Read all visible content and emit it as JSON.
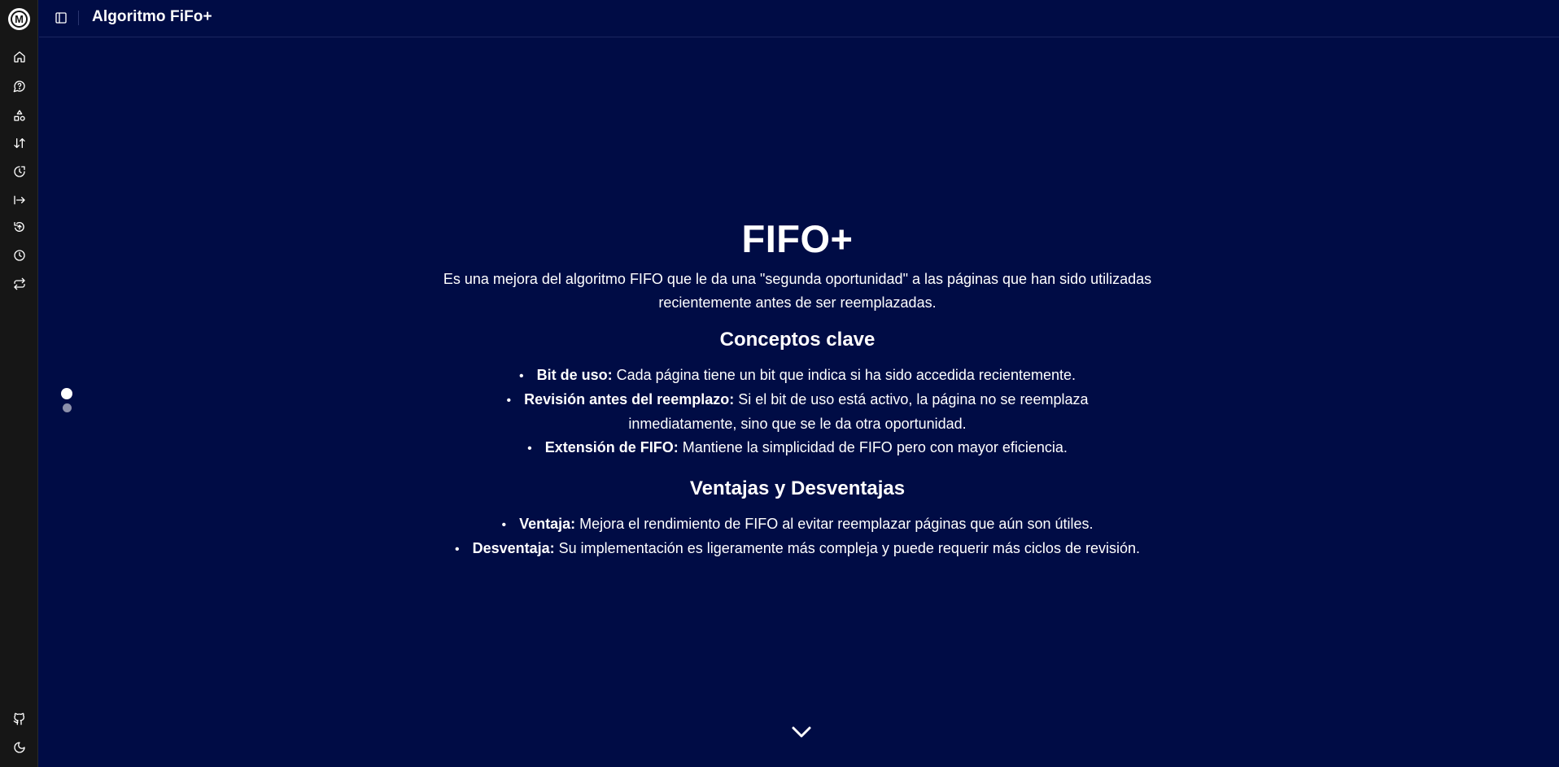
{
  "app": {
    "logo_letter": "M",
    "title": "Algoritmo FiFo+"
  },
  "sidebar": {
    "items": [
      {
        "icon": "home-icon"
      },
      {
        "icon": "chat-help-icon"
      },
      {
        "icon": "shapes-icon"
      },
      {
        "icon": "sort-arrows-icon"
      },
      {
        "icon": "clock-refresh-icon"
      },
      {
        "icon": "arrow-right-to-line-icon"
      },
      {
        "icon": "circle-arrow-up-icon"
      },
      {
        "icon": "clock-icon"
      },
      {
        "icon": "repeat-icon"
      }
    ],
    "bottom": [
      {
        "icon": "github-icon"
      },
      {
        "icon": "moon-icon"
      }
    ]
  },
  "slides": {
    "count": 2,
    "active": 1
  },
  "content": {
    "title": "FIFO+",
    "intro": "Es una mejora del algoritmo FIFO que le da una \"segunda oportunidad\" a las páginas que han sido utilizadas recientemente antes de ser reemplazadas.",
    "concepts_title": "Conceptos clave",
    "concepts": [
      {
        "term": "Bit de uso:",
        "text": " Cada página tiene un bit que indica si ha sido accedida recientemente."
      },
      {
        "term": "Revisión antes del reemplazo:",
        "text": " Si el bit de uso está activo, la página no se reemplaza inmediatamente, sino que se le da otra oportunidad."
      },
      {
        "term": "Extensión de FIFO:",
        "text": " Mantiene la simplicidad de FIFO pero con mayor eficiencia."
      }
    ],
    "pros_cons_title": "Ventajas y Desventajas",
    "pros_cons": [
      {
        "term": "Ventaja:",
        "text": " Mejora el rendimiento de FIFO al evitar reemplazar páginas que aún son útiles."
      },
      {
        "term": "Desventaja:",
        "text": " Su implementación es ligeramente más compleja y puede requerir más ciclos de revisión."
      }
    ]
  },
  "colors": {
    "background": "#000c45",
    "sidebar": "#161616",
    "text": "#ffffff"
  }
}
